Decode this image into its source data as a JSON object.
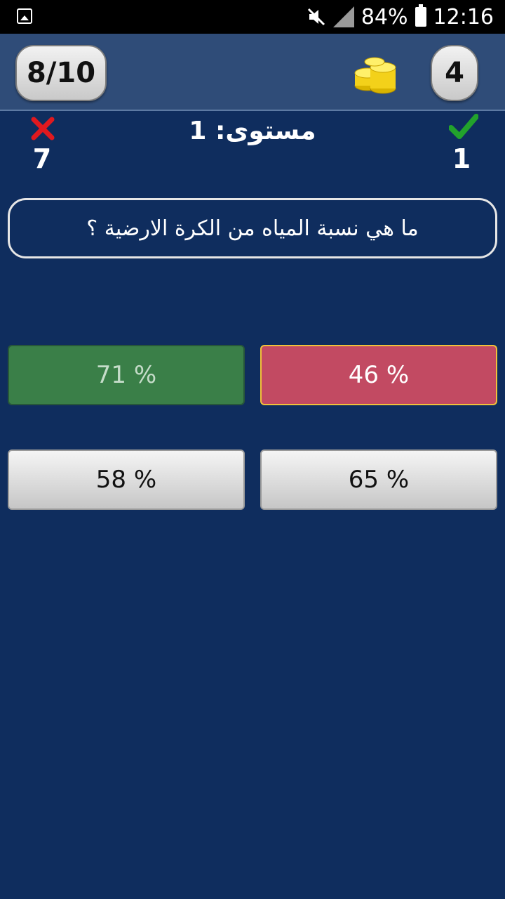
{
  "status_bar": {
    "battery": "84%",
    "time": "12:16",
    "icons": [
      "gallery-icon",
      "mute-icon",
      "signal-icon",
      "battery-charging-icon"
    ]
  },
  "header": {
    "progress": "8/10",
    "coins": "4",
    "coins_icon": "gold-coins-icon"
  },
  "score": {
    "wrong_icon": "red-x-icon",
    "wrong_count": "7",
    "correct_icon": "green-check-icon",
    "correct_count": "1",
    "level": "مستوى: 1"
  },
  "question": "ما هي نسبة المياه من الكرة الارضية ؟",
  "answers": [
    {
      "label": "71 %",
      "state": "correct",
      "color": "#3a7f48"
    },
    {
      "label": "46 %",
      "state": "selected-wrong",
      "color": "#c24a62"
    },
    {
      "label": "58 %",
      "state": "normal"
    },
    {
      "label": "65 %",
      "state": "normal"
    }
  ],
  "colors": {
    "background": "#0f2d5e",
    "header": "#2f4c78",
    "correct": "#3a7f48",
    "wrong": "#c24a62",
    "highlight_border": "#f0c23a"
  }
}
